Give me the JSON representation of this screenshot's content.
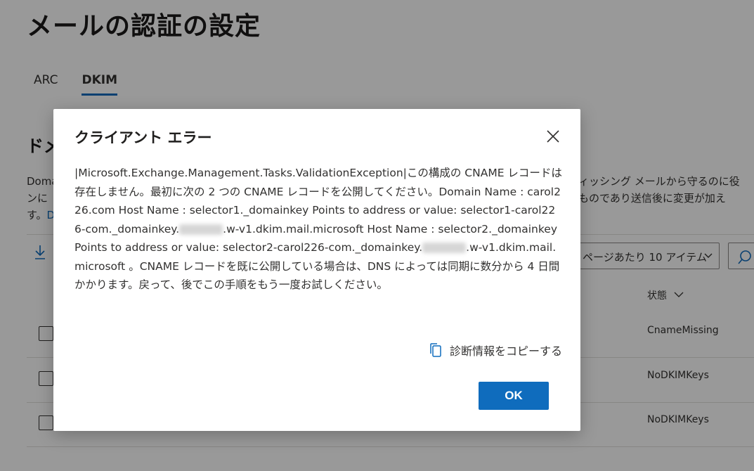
{
  "page": {
    "title": "メールの認証の設定",
    "tabs": [
      {
        "label": "ARC",
        "active": false
      },
      {
        "label": "DKIM",
        "active": true
      }
    ],
    "section_heading": "ドメ",
    "description": {
      "left_lines": [
        "Doma",
        "ンに",
        "す。"
      ],
      "link_fragment": "D",
      "right_lines": [
        "ィッシング メールから守るのに役",
        "ものであり送信後に変更が加え"
      ]
    },
    "pagesize_label": "ページあたり 10 アイテム",
    "table": {
      "status_header": "状態",
      "rows": [
        {
          "status": "CnameMissing"
        },
        {
          "status": "NoDKIMKeys"
        },
        {
          "status": "NoDKIMKeys"
        }
      ]
    }
  },
  "dialog": {
    "title": "クライアント エラー",
    "body_part1": "|Microsoft.Exchange.Management.Tasks.ValidationException|この構成の CNAME レコードは存在しません。最初に次の 2 つの CNAME レコードを公開してください。Domain Name : carol226.com Host Name : selector1._domainkey Points to address or value: selector1-carol226-com._domainkey.",
    "body_part2": ".w-v1.dkim.mail.microsoft Host Name : selector2._domainkey Points to address or value: selector2-carol226-com._domainkey.",
    "body_part3": ".w-v1.dkim.mail.microsoft 。CNAME レコードを既に公開している場合は、DNS によっては同期に数分から 4 日間かかります。戻って、後でこの手順をもう一度お試しください。",
    "copy_label": "診断情報をコピーする",
    "ok_label": "OK"
  },
  "colors": {
    "accent": "#0f6cbd",
    "overlay": "rgba(0,0,0,0.4)"
  }
}
